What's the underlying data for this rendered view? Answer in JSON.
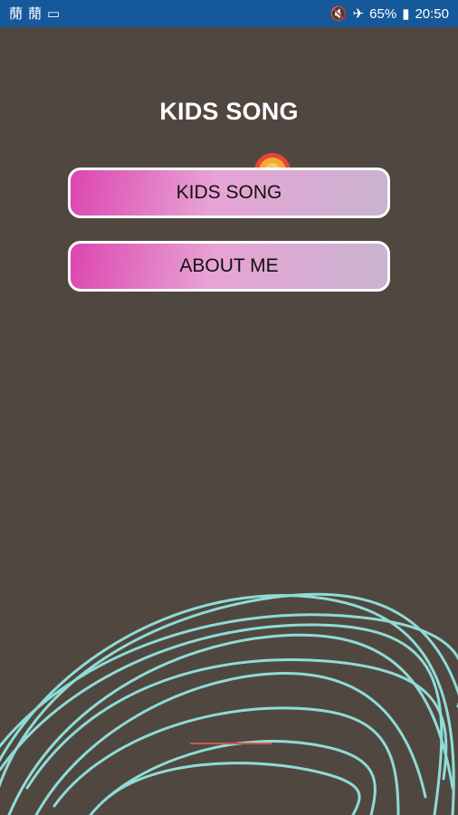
{
  "status_bar": {
    "left_icons": [
      "notification-icon",
      "notification-icon",
      "screenshot-icon"
    ],
    "right_icons": [
      "mute-icon",
      "airplane-mode-icon",
      "battery-icon"
    ],
    "battery": "65%",
    "time": "20:50"
  },
  "main": {
    "title": "KIDS SONG",
    "buttons": [
      {
        "label": "KIDS SONG"
      },
      {
        "label": "ABOUT ME"
      }
    ]
  },
  "colors": {
    "background": "#514741",
    "status_bar": "#16599a",
    "button_gradient_start": "#dc46b0",
    "button_gradient_end": "#c8b4d0",
    "scribble": "#8fdcd6"
  }
}
